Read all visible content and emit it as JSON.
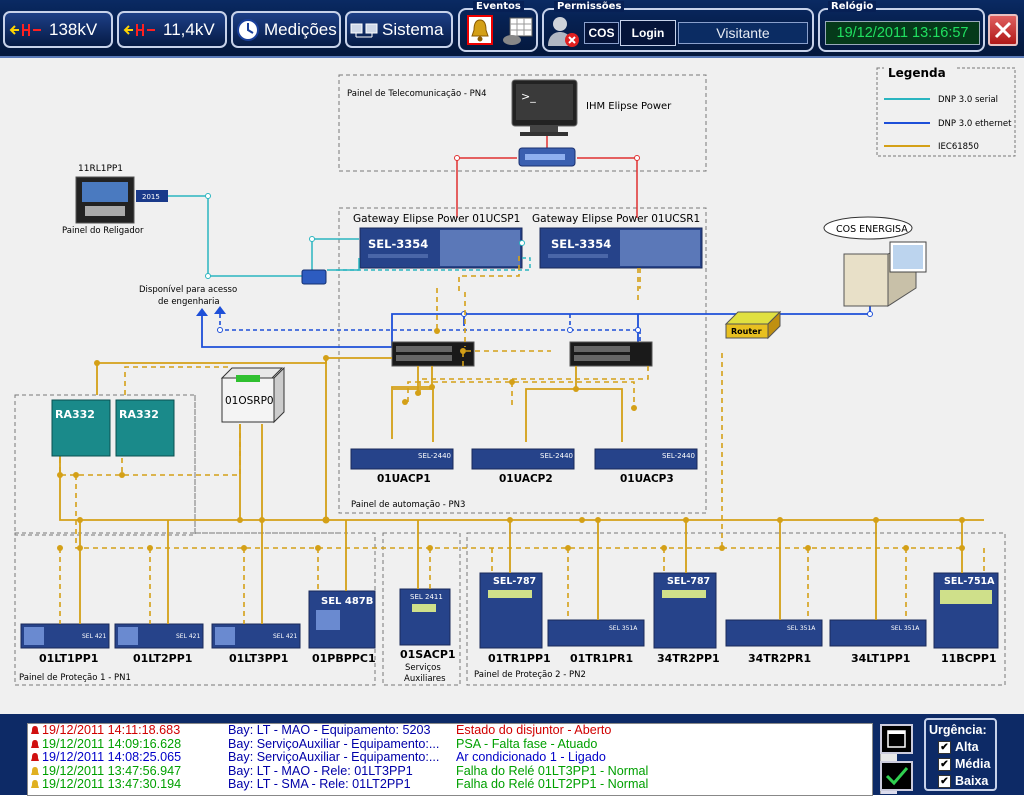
{
  "topbar": {
    "btn_138": "138kV",
    "btn_114": "11,4kV",
    "btn_medicoes": "Medições",
    "btn_sistema": "Sistema",
    "eventos_title": "Eventos",
    "permissoes_title": "Permissões",
    "cos_label": "COS",
    "login_label": "Login",
    "user": "Visitante",
    "relogio_title": "Relógio",
    "clock": "19/12/2011 13:16:57"
  },
  "diagram": {
    "pn4_title": "Painel de Telecomunicação - PN4",
    "ihm_label": "IHM Elipse Power",
    "legend_title": "Legenda",
    "legend": [
      {
        "label": "DNP 3.0 serial",
        "color": "#2ab5c0"
      },
      {
        "label": "DNP 3.0 ethernet",
        "color": "#1d4fd8"
      },
      {
        "label": "IEC61850",
        "color": "#d4a017"
      }
    ],
    "relig_name": "11RL1PP1",
    "relig_sub": "Painel do Religador",
    "relig_tag": "2015",
    "gw1_title": "Gateway Elipse Power 01UCSP1",
    "gw2_title": "Gateway Elipse Power 01UCSR1",
    "gw_model": "SEL-3354",
    "cos_energisa": "COS ENERGISA",
    "router": "Router",
    "eng_access_1": "Disponível para acesso",
    "eng_access_2": "de engenharia",
    "ra332_1": "RA332",
    "ra332_2": "RA332",
    "osrp": "01OSRP0",
    "uacp_model": "SEL-2440",
    "uacp": [
      "01UACP1",
      "01UACP2",
      "01UACP3"
    ],
    "pn3_title": "Painel de automação - PN3",
    "pn1_title": "Painel de Proteção 1 - PN1",
    "pn2_title": "Painel de Proteção 2 - PN2",
    "sel421": "SEL 421",
    "sel487b": "SEL 487B",
    "sel2411": "SEL 2411",
    "sel787": "SEL-787",
    "sel351a": "SEL 351A",
    "sel751a": "SEL-751A",
    "pn1_devices": [
      "01LT1PP1",
      "01LT2PP1",
      "01LT3PP1",
      "01PBPPC1"
    ],
    "sacp": "01SACP1",
    "sacp_sub1": "Serviços",
    "sacp_sub2": "Auxiliares",
    "pn2_devices": [
      "01TR1PP1",
      "01TR1PR1",
      "34TR2PP1",
      "34TR2PR1",
      "34LT1PP1",
      "11BCPP1"
    ]
  },
  "events": [
    {
      "date": "19/12/2011 14:11:18.683",
      "bay": "Bay: LT - MAO - Equipamento: 5203",
      "msg": "Estado do disjuntor - Aberto",
      "color": "#d00000",
      "icon": "bell-red"
    },
    {
      "date": "19/12/2011 14:09:16.628",
      "bay": "Bay: ServiçoAuxiliar - Equipamento:...",
      "msg": "PSA - Falta fase - Atuado",
      "color": "#00a000",
      "icon": "bell-red"
    },
    {
      "date": "19/12/2011 14:08:25.065",
      "bay": "Bay: ServiçoAuxiliar - Equipamento:...",
      "msg": "Ar condicionado 1 - Ligado",
      "color": "#0000c8",
      "icon": "bell-red"
    },
    {
      "date": "19/12/2011 13:47:56.947",
      "bay": "Bay: LT - MAO - Rele: 01LT3PP1",
      "msg": "Falha do Relé 01LT3PP1 - Normal",
      "color": "#00a000",
      "icon": "bell-yellow"
    },
    {
      "date": "19/12/2011 13:47:30.194",
      "bay": "Bay: LT - SMA - Rele: 01LT2PP1",
      "msg": "Falha do Relé 01LT2PP1 - Normal",
      "color": "#00a000",
      "icon": "bell-yellow"
    }
  ],
  "urgency": {
    "title": "Urgência:",
    "items": [
      {
        "label": "Alta",
        "checked": true
      },
      {
        "label": "Média",
        "checked": true
      },
      {
        "label": "Baixa",
        "checked": true
      }
    ]
  }
}
